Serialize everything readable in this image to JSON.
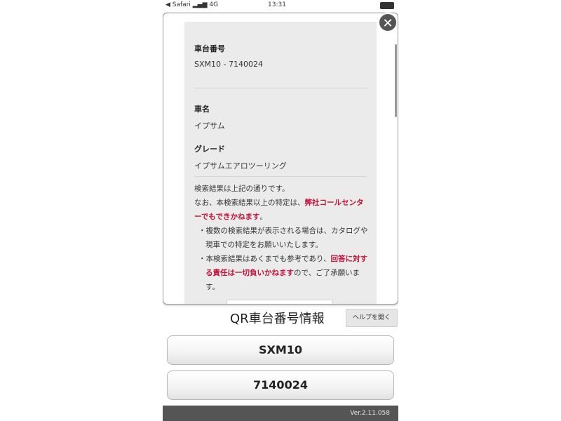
{
  "status_bar": {
    "left": "◀ Safari ▂▄▆ 4G",
    "time": "13:31"
  },
  "modal": {
    "sections": [
      {
        "label": "車台番号",
        "value": "SXM10 - 7140024"
      },
      {
        "label": "車名",
        "value": "イプサム"
      },
      {
        "label": "グレード",
        "value": "イプサムエアロツーリング"
      }
    ],
    "note": {
      "line1": "検索結果は上記の通りです。",
      "line2_pre": "なお、本検索結果以上の特定は、",
      "line2_red": "弊社コールセンターでもできかねます",
      "line2_post": "。",
      "bullet1": "・複数の検索結果が表示される場合は、カタログや現車での特定をお願いいたします。",
      "bullet2_pre": "・本検索結果はあくまでも参考であり、",
      "bullet2_red": "回答に対する責任は一切負いかねます",
      "bullet2_post": "ので、ご了承願います。"
    }
  },
  "main": {
    "title": "QR車台番号情報",
    "help_label": "ヘルプを開く",
    "model_code": "SXM10",
    "serial_number": "7140024"
  },
  "footer": {
    "version": "Ver.2.11.058"
  },
  "colors": {
    "accent_red": "#c4123a",
    "footer_bg": "#555555"
  }
}
